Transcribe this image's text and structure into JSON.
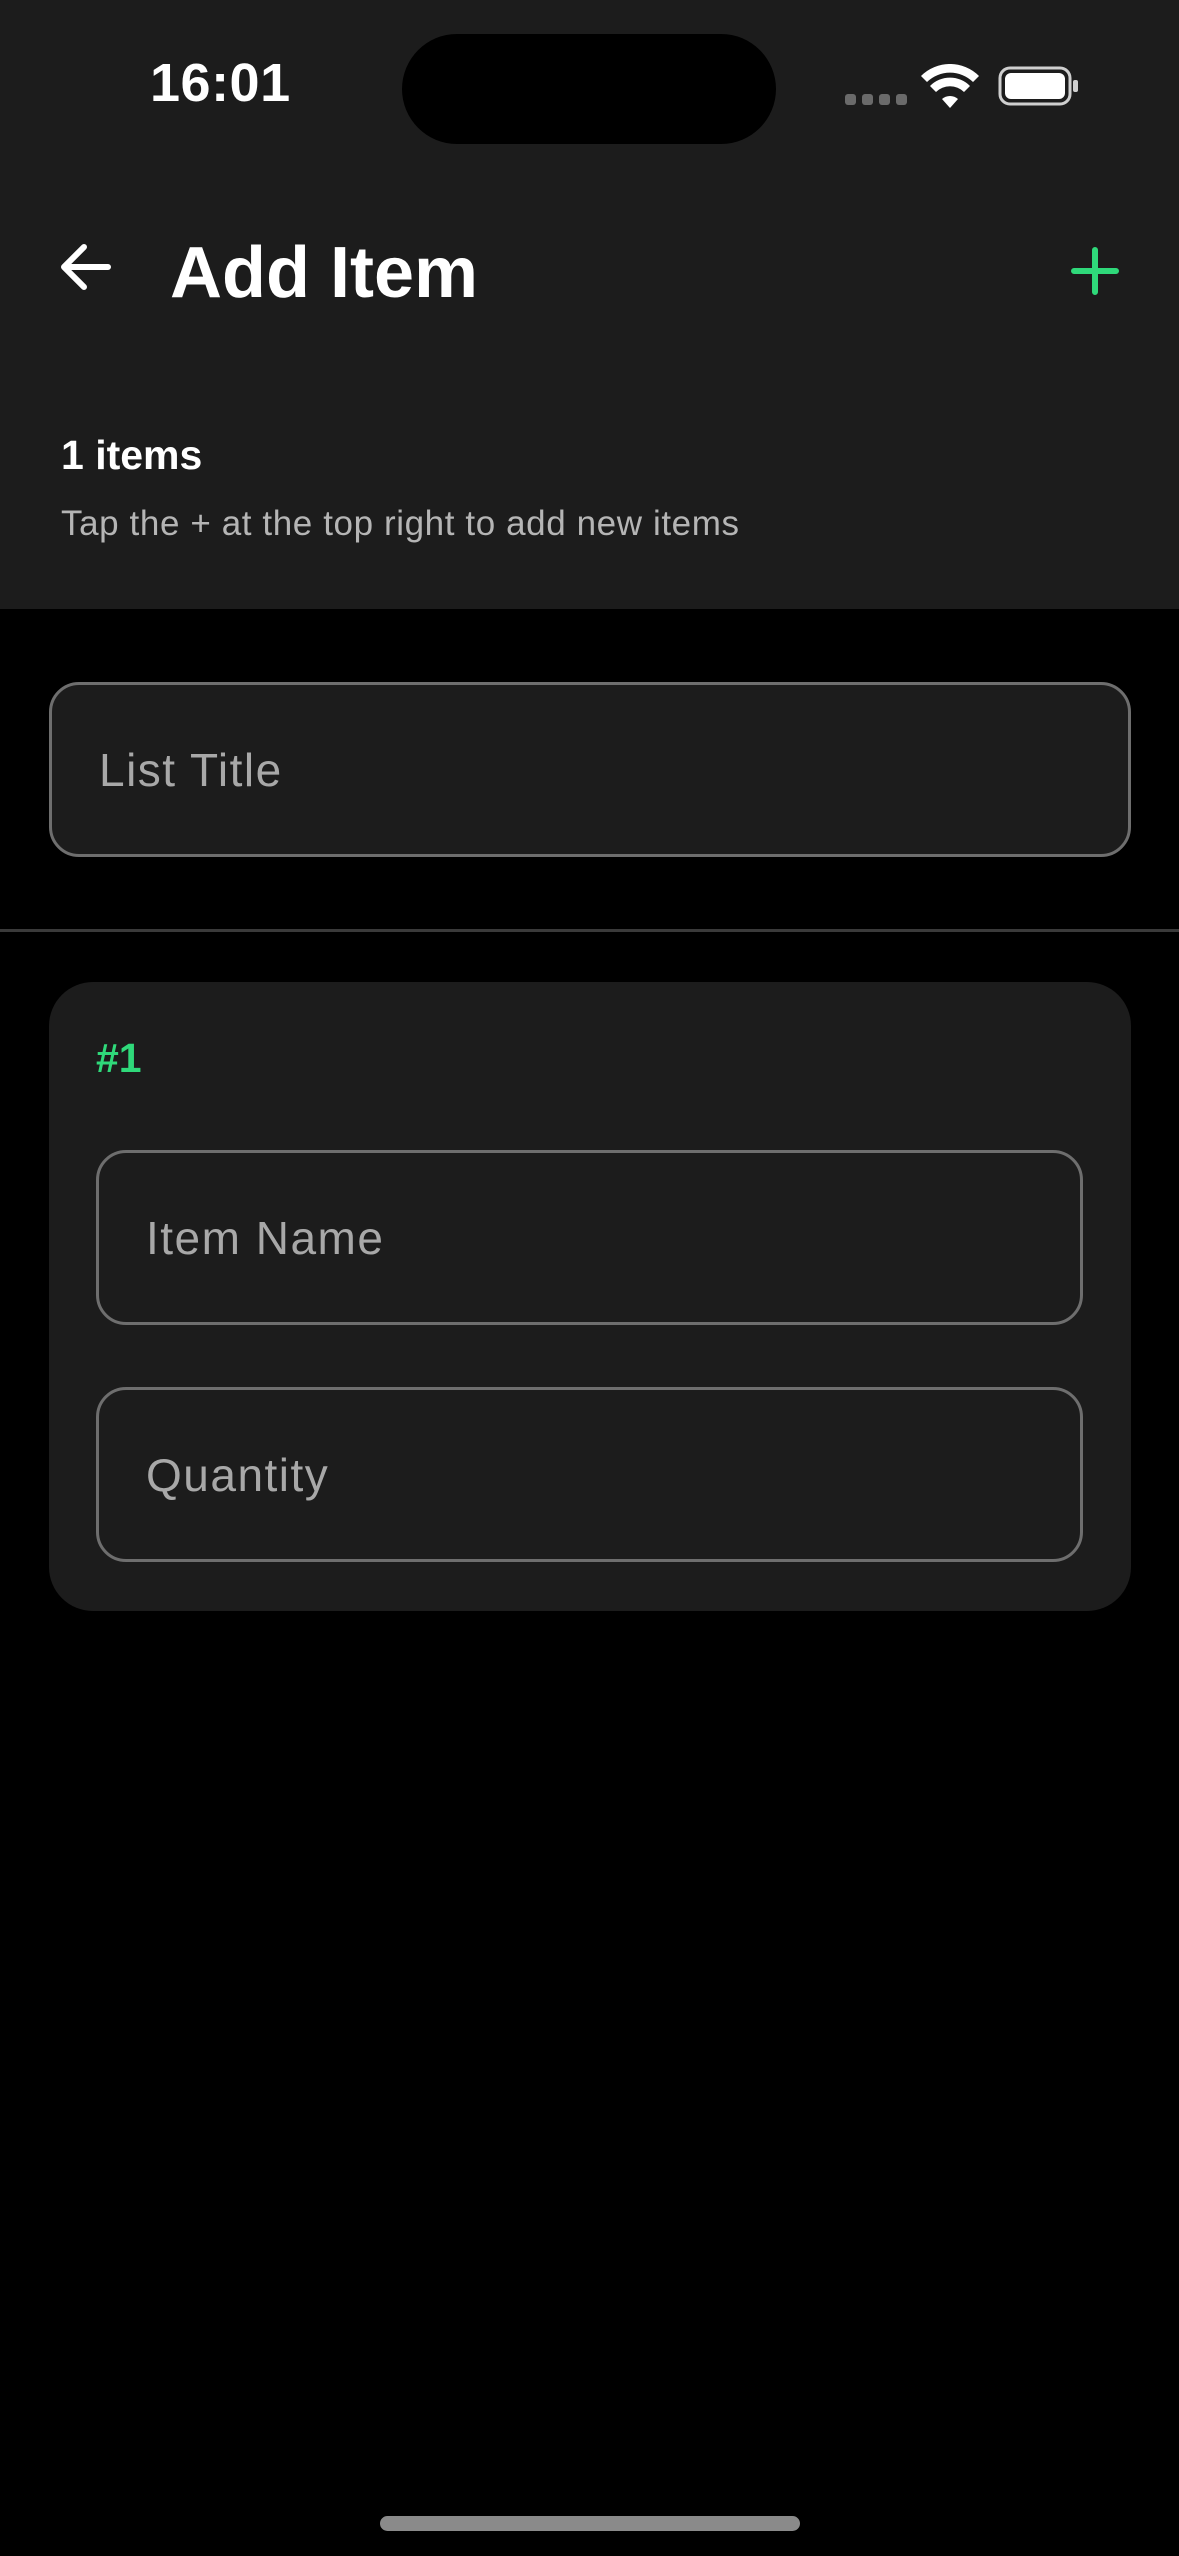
{
  "status_bar": {
    "time": "16:01",
    "icons": [
      "signal-dots-icon",
      "wifi-icon",
      "battery-icon"
    ]
  },
  "header": {
    "title": "Add Item",
    "back_icon": "arrow-left-icon",
    "add_icon": "plus-icon"
  },
  "summary": {
    "count_label": "1 items",
    "hint": "Tap the + at the top right to add new items"
  },
  "list_title_field": {
    "placeholder": "List Title",
    "value": ""
  },
  "items": [
    {
      "number_label": "#1",
      "name_field": {
        "placeholder": "Item Name",
        "value": ""
      },
      "quantity_field": {
        "placeholder": "Quantity",
        "value": ""
      }
    }
  ],
  "colors": {
    "accent": "#2fd97a",
    "surface": "#1c1c1c",
    "background": "#000000",
    "border": "#6e6e6e"
  }
}
